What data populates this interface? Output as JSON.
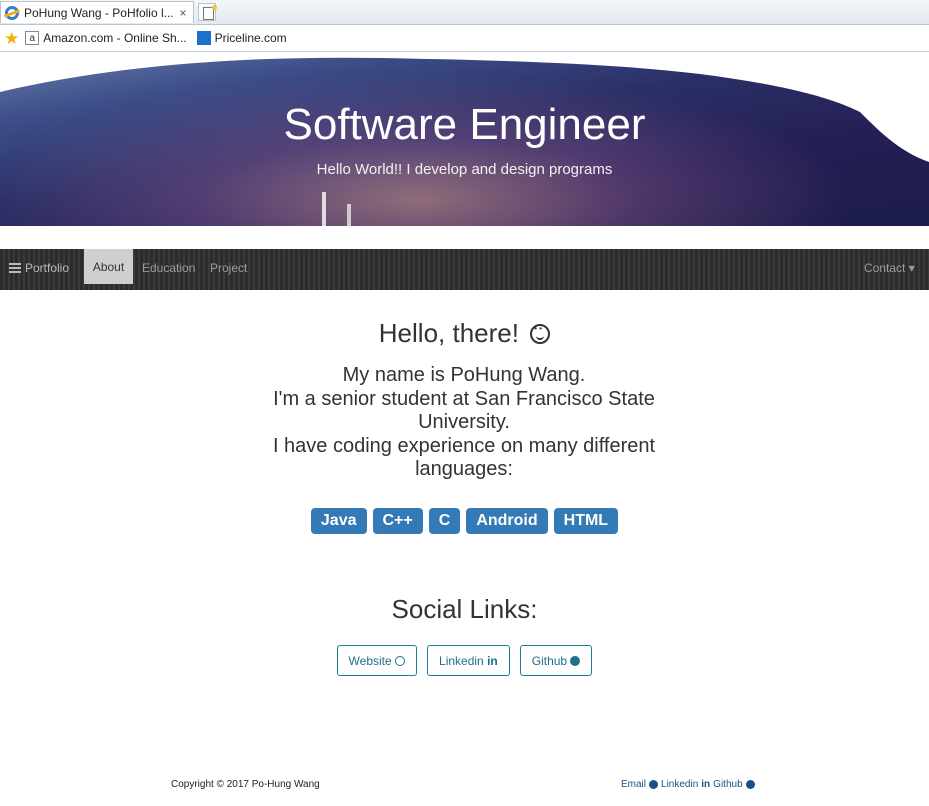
{
  "browser": {
    "tab_title": "PoHung Wang - PoHfolio l...",
    "tab_close": "×",
    "favorites": [
      {
        "label": "Amazon.com - Online Sh...",
        "icon": "amazon-favicon"
      },
      {
        "label": "Priceline.com",
        "icon": "priceline-favicon"
      }
    ]
  },
  "hero": {
    "title": "Software Engineer",
    "subtitle": "Hello World!! I develop and design programs"
  },
  "navbar": {
    "brand": "Portfolio",
    "items": [
      "About",
      "Education",
      "Project"
    ],
    "active_index": 0,
    "contact": "Contact ▾"
  },
  "main": {
    "greeting": "Hello, there!",
    "intro_lines": [
      "My name is PoHung Wang.",
      "I'm a senior student at San Francisco State",
      "University.",
      "I have coding experience on many different",
      "languages:"
    ],
    "languages": [
      "Java",
      "C++",
      "C",
      "Android",
      "HTML"
    ],
    "social_title": "Social Links:",
    "social_links": [
      {
        "label": "Website",
        "icon": "globe-icon"
      },
      {
        "label": "Linkedin",
        "icon": "linkedin-icon"
      },
      {
        "label": "Github",
        "icon": "github-icon"
      }
    ]
  },
  "footer": {
    "copyright": "Copyright © 2017 Po-Hung Wang",
    "links": [
      "Email",
      "Linkedin",
      "Github"
    ]
  },
  "colors": {
    "primary_badge": "#337ab7",
    "navbar_bg": "#2c2c2c",
    "social_border": "#1e7f9c"
  }
}
